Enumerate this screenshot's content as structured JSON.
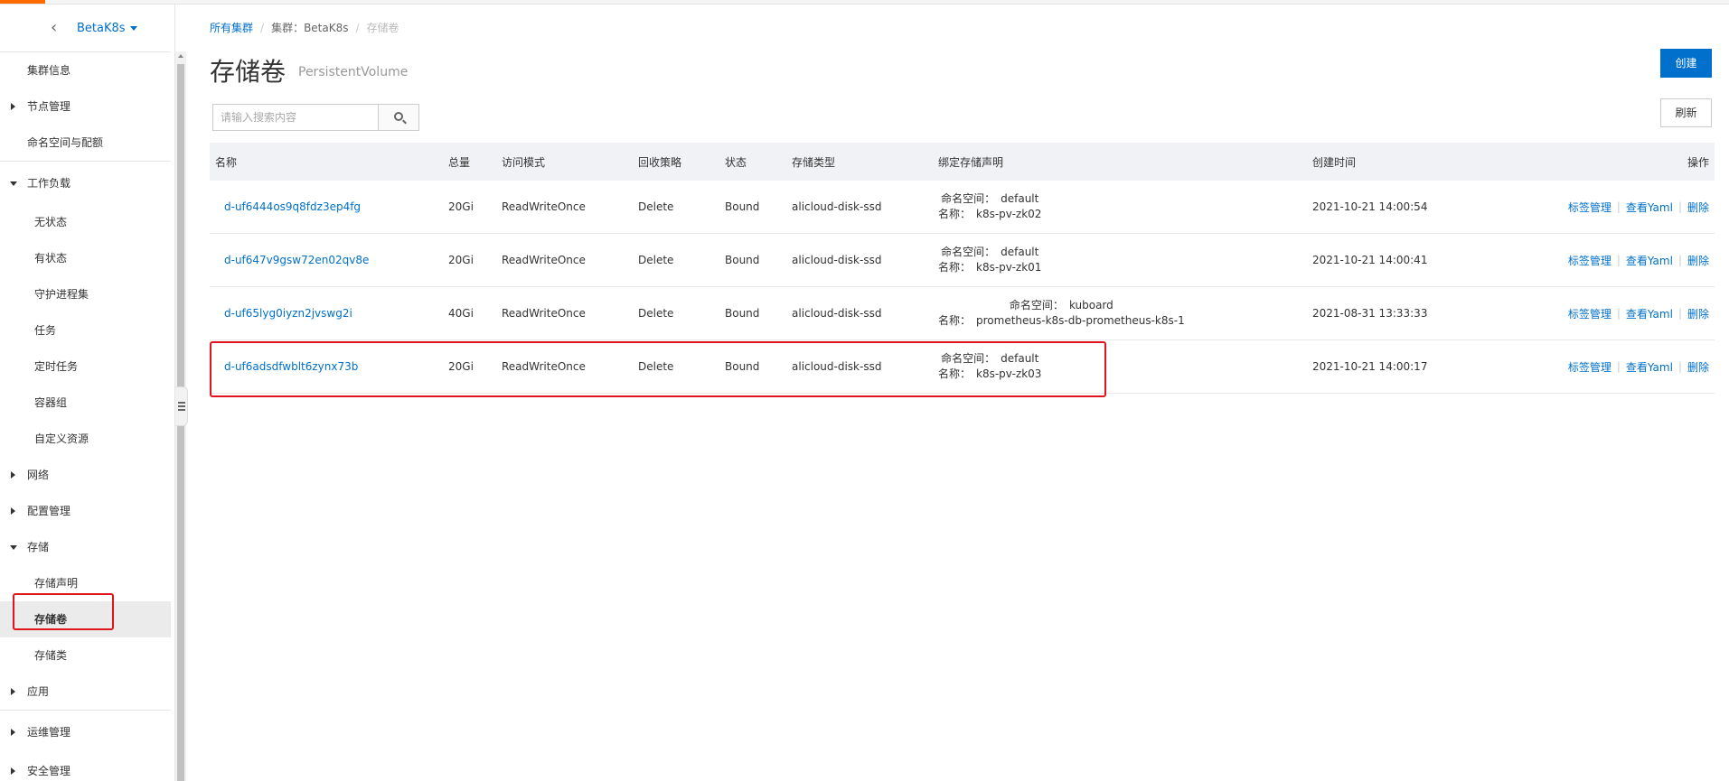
{
  "sidebar": {
    "cluster_name": "BetaK8s",
    "items": [
      {
        "label": "集群信息"
      },
      {
        "label": "节点管理"
      },
      {
        "label": "命名空间与配额"
      },
      {
        "label": "工作负载"
      },
      {
        "label": "无状态"
      },
      {
        "label": "有状态"
      },
      {
        "label": "守护进程集"
      },
      {
        "label": "任务"
      },
      {
        "label": "定时任务"
      },
      {
        "label": "容器组"
      },
      {
        "label": "自定义资源"
      },
      {
        "label": "网络"
      },
      {
        "label": "配置管理"
      },
      {
        "label": "存储"
      },
      {
        "label": "存储声明"
      },
      {
        "label": "存储卷"
      },
      {
        "label": "存储类"
      },
      {
        "label": "应用"
      },
      {
        "label": "运维管理"
      },
      {
        "label": "安全管理"
      }
    ]
  },
  "breadcrumb": {
    "all_clusters": "所有集群",
    "cluster": "集群：BetaK8s",
    "current": "存储卷"
  },
  "page": {
    "title": "存储卷",
    "subtitle": "PersistentVolume",
    "create_label": "创建",
    "refresh_label": "刷新"
  },
  "search": {
    "placeholder": "请输入搜索内容",
    "value": ""
  },
  "table": {
    "headers": {
      "name": "名称",
      "capacity": "总量",
      "access_mode": "访问模式",
      "reclaim_policy": "回收策略",
      "status": "状态",
      "storage_class": "存储类型",
      "claim": "绑定存储声明",
      "created": "创建时间",
      "actions": "操作"
    },
    "claim_ns_label": "命名空间：",
    "claim_name_label": "名称：",
    "action_labels": {
      "tags": "标签管理",
      "yaml": "查看Yaml",
      "delete": "删除"
    },
    "rows": [
      {
        "name": "d-uf6444os9q8fdz3ep4fg",
        "capacity": "20Gi",
        "access_mode": "ReadWriteOnce",
        "reclaim_policy": "Delete",
        "status": "Bound",
        "storage_class": "alicloud-disk-ssd",
        "claim_namespace": "default",
        "claim_name": "k8s-pv-zk02",
        "created": "2021-10-21 14:00:54"
      },
      {
        "name": "d-uf647v9gsw72en02qv8e",
        "capacity": "20Gi",
        "access_mode": "ReadWriteOnce",
        "reclaim_policy": "Delete",
        "status": "Bound",
        "storage_class": "alicloud-disk-ssd",
        "claim_namespace": "default",
        "claim_name": "k8s-pv-zk01",
        "created": "2021-10-21 14:00:41"
      },
      {
        "name": "d-uf65lyg0iyzn2jvswg2i",
        "capacity": "40Gi",
        "access_mode": "ReadWriteOnce",
        "reclaim_policy": "Delete",
        "status": "Bound",
        "storage_class": "alicloud-disk-ssd",
        "claim_namespace": "kuboard",
        "claim_name": "prometheus-k8s-db-prometheus-k8s-1",
        "created": "2021-08-31 13:33:33"
      },
      {
        "name": "d-uf6adsdfwblt6zynx73b",
        "capacity": "20Gi",
        "access_mode": "ReadWriteOnce",
        "reclaim_policy": "Delete",
        "status": "Bound",
        "storage_class": "alicloud-disk-ssd",
        "claim_namespace": "default",
        "claim_name": "k8s-pv-zk03",
        "created": "2021-10-21 14:00:17"
      }
    ]
  },
  "colors": {
    "accent": "#0070cc",
    "brand": "#ff6a00",
    "highlight": "#e0141e"
  }
}
